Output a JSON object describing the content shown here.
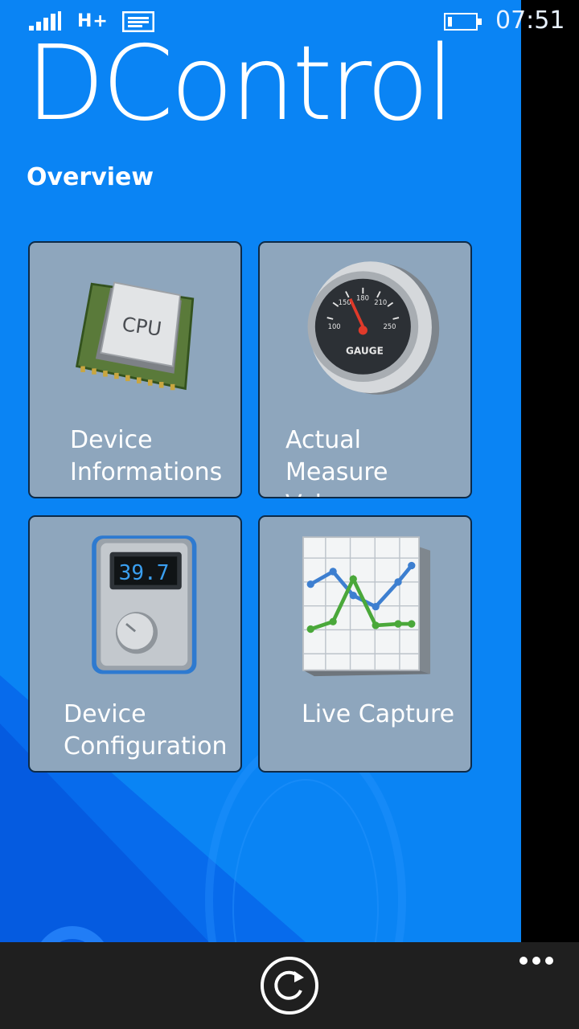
{
  "statusbar": {
    "network": "H+",
    "time": "07:51"
  },
  "app": {
    "title": "DControl",
    "section": "Overview"
  },
  "tiles": [
    {
      "label": "Device\nInformations",
      "icon": "cpu-icon",
      "chip_text": "CPU"
    },
    {
      "label": "Actual Measure\nValues",
      "icon": "gauge-icon",
      "dial": [
        "100",
        "150",
        "180",
        "210",
        "250"
      ],
      "dial_title": "GAUGE"
    },
    {
      "label": "Device\nConfiguration",
      "icon": "thermostat-icon",
      "display": "39.7"
    },
    {
      "label": "Live Capture",
      "icon": "line-chart-icon"
    }
  ],
  "appbar": {
    "icons": [
      "refresh-icon",
      "more-icon"
    ]
  },
  "colors": {
    "background": "#0a84f4",
    "tile": "#8ea6bd",
    "tile_border": "#0d2a47",
    "appbar": "#1f1f1f"
  }
}
